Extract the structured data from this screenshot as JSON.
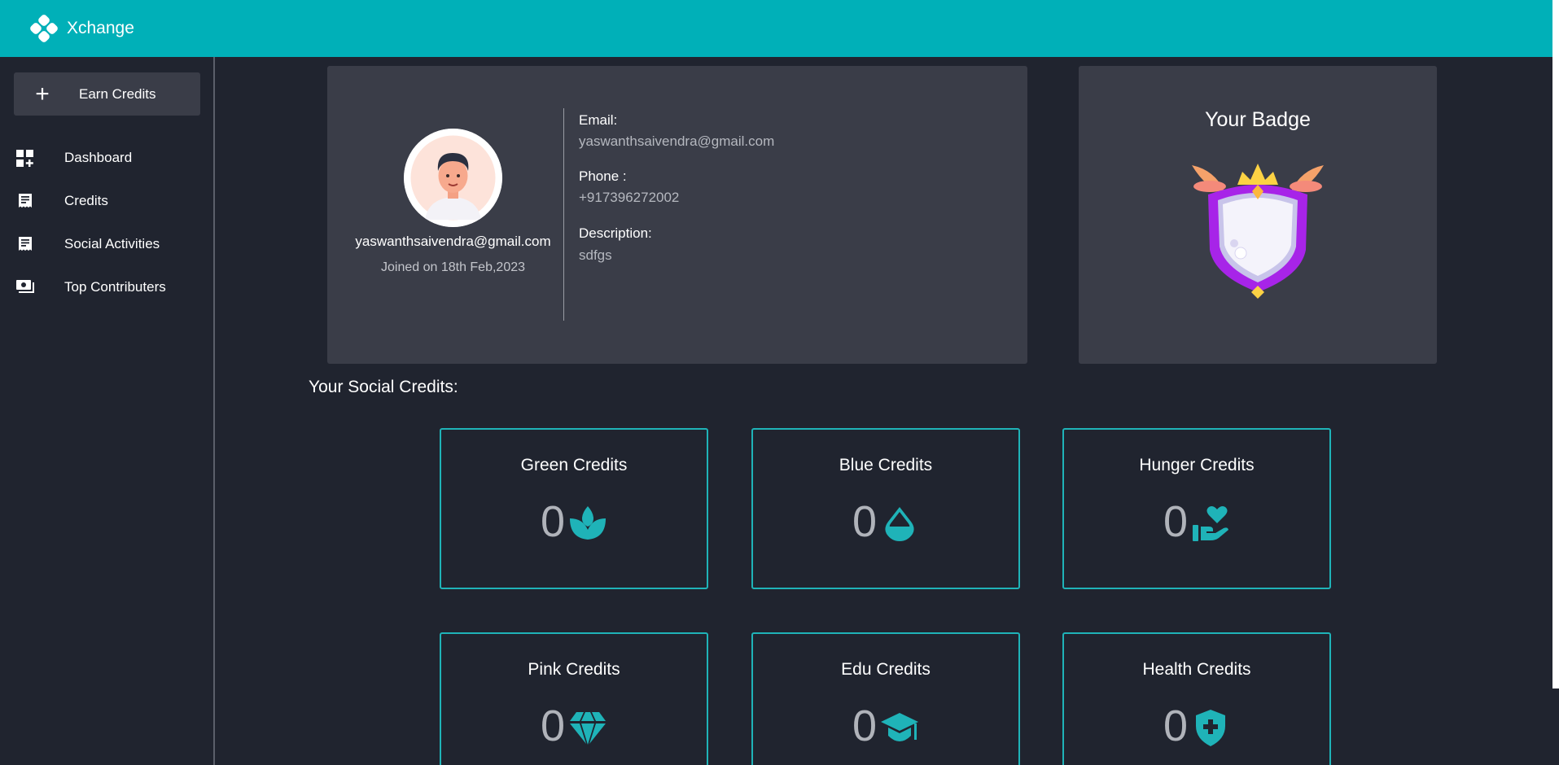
{
  "app": {
    "brand_name": "Xchange",
    "brand_color": "#00b0b8",
    "logo_icon": "clover-logo-icon"
  },
  "sidebar": {
    "earn_button": {
      "icon": "plus-icon",
      "label": "Earn Credits"
    },
    "items": [
      {
        "icon": "dashboard-icon",
        "label": "Dashboard"
      },
      {
        "icon": "receipt-icon",
        "label": "Credits"
      },
      {
        "icon": "receipt-icon",
        "label": "Social Activities"
      },
      {
        "icon": "money-icon",
        "label": "Top Contributers"
      }
    ]
  },
  "profile": {
    "avatar": "user-avatar",
    "email_display": "yaswanthsaivendra@gmail.com",
    "joined": "Joined on 18th Feb,2023",
    "fields": [
      {
        "label": "Email:",
        "value": "yaswanthsaivendra@gmail.com"
      },
      {
        "label": "Phone :",
        "value": "+917396272002"
      },
      {
        "label": "Description:",
        "value": "sdfgs"
      }
    ]
  },
  "badge": {
    "title": "Your Badge",
    "icon": "shield-badge-icon"
  },
  "credits": {
    "title": "Your Social Credits:",
    "accent": "#1fb3b8",
    "items": [
      {
        "name": "Green Credits",
        "value": "0",
        "icon": "plant-icon"
      },
      {
        "name": "Blue Credits",
        "value": "0",
        "icon": "water-drop-icon"
      },
      {
        "name": "Hunger Credits",
        "value": "0",
        "icon": "hand-heart-icon"
      },
      {
        "name": "Pink Credits",
        "value": "0",
        "icon": "diamond-icon"
      },
      {
        "name": "Edu Credits",
        "value": "0",
        "icon": "graduation-cap-icon"
      },
      {
        "name": "Health Credits",
        "value": "0",
        "icon": "shield-plus-icon"
      }
    ]
  }
}
